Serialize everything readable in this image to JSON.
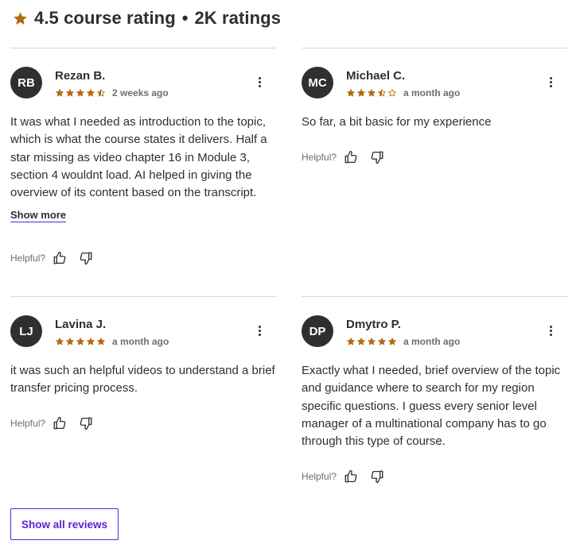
{
  "header": {
    "rating_text": "4.5 course rating",
    "separator": "•",
    "count_text": "2K ratings",
    "star_icon": "star-icon",
    "star_color": "#b4690e"
  },
  "colors": {
    "star": "#b4690e",
    "avatar_bg": "#2d2f31",
    "link_purple": "#5624d0",
    "muted": "#6a6f73",
    "divider": "#d1d7dc"
  },
  "reviews": [
    {
      "initials": "RB",
      "name": "Rezan B.",
      "rating": 4.5,
      "date": "2 weeks ago",
      "text": "It was what I needed as introduction to the topic, which is what the course states it delivers. Half a star missing as video chapter 16 in Module 3, section 4 wouldnt load. AI helped in giving the overview of its content based on the transcript.",
      "show_more": "Show more",
      "helpful_label": "Helpful?"
    },
    {
      "initials": "MC",
      "name": "Michael C.",
      "rating": 3.5,
      "date": "a month ago",
      "text": "So far, a bit basic for my experience",
      "helpful_label": "Helpful?"
    },
    {
      "initials": "LJ",
      "name": "Lavina J.",
      "rating": 5,
      "date": "a month ago",
      "text": "it was such an helpful videos to understand a brief transfer pricing process.",
      "helpful_label": "Helpful?"
    },
    {
      "initials": "DP",
      "name": "Dmytro P.",
      "rating": 5,
      "date": "a month ago",
      "text": "Exactly what I needed, brief overview of the topic and guidance where to search for my region specific questions. I guess every senior level manager of a multinational company has to go through this type of course.",
      "helpful_label": "Helpful?"
    }
  ],
  "footer": {
    "show_all_label": "Show all reviews"
  }
}
